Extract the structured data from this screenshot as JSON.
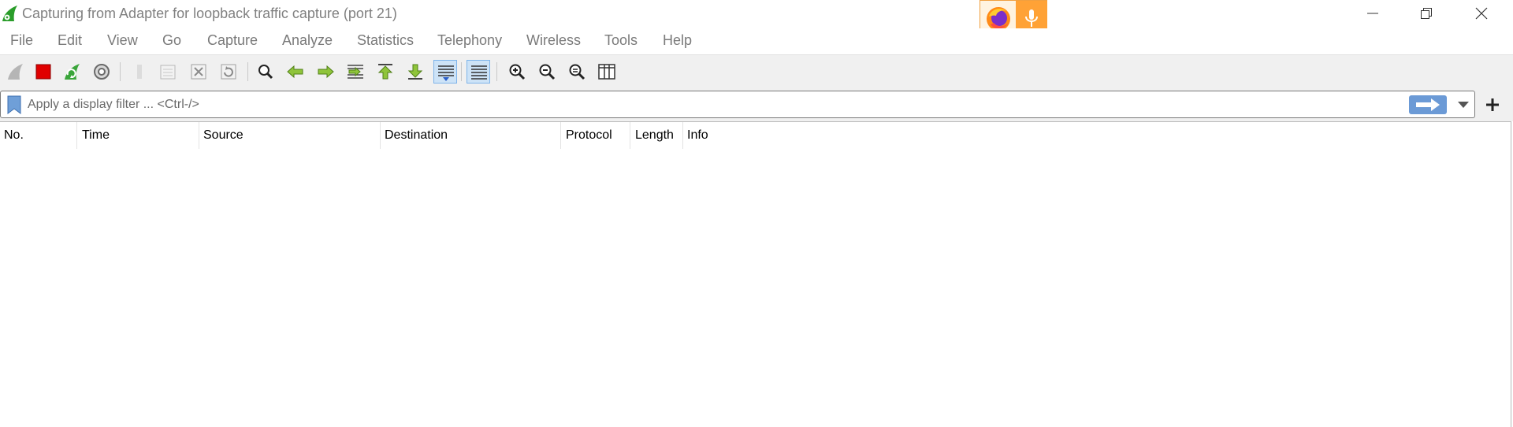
{
  "window": {
    "title": "Capturing from Adapter for loopback traffic capture (port 21)",
    "minimize_icon": "minimize-icon",
    "restore_icon": "restore-icon",
    "close_icon": "close-icon"
  },
  "overlay": {
    "firefox_icon": "firefox-icon",
    "mic_icon": "microphone-icon",
    "accent": "#ffa236"
  },
  "menu": {
    "items": [
      "File",
      "Edit",
      "View",
      "Go",
      "Capture",
      "Analyze",
      "Statistics",
      "Telephony",
      "Wireless",
      "Tools",
      "Help"
    ]
  },
  "toolbar": {
    "buttons": [
      {
        "icon": "start-capture-icon",
        "state": "disabled"
      },
      {
        "icon": "stop-capture-icon",
        "color": "#e00000"
      },
      {
        "icon": "restart-capture-icon"
      },
      {
        "icon": "capture-options-icon"
      },
      {
        "icon": "open-file-icon",
        "state": "disabled"
      },
      {
        "icon": "save-file-icon",
        "state": "disabled"
      },
      {
        "icon": "close-file-icon",
        "state": "disabled"
      },
      {
        "icon": "reload-file-icon",
        "state": "disabled"
      },
      {
        "icon": "find-packet-icon"
      },
      {
        "icon": "go-back-icon"
      },
      {
        "icon": "go-forward-icon"
      },
      {
        "icon": "go-to-packet-icon"
      },
      {
        "icon": "go-to-first-packet-icon"
      },
      {
        "icon": "go-to-last-packet-icon"
      },
      {
        "icon": "auto-scroll-icon",
        "state": "active"
      },
      {
        "icon": "colorize-icon",
        "state": "active"
      },
      {
        "icon": "zoom-in-icon"
      },
      {
        "icon": "zoom-out-icon"
      },
      {
        "icon": "normal-size-icon"
      },
      {
        "icon": "resize-columns-icon"
      }
    ]
  },
  "filter": {
    "placeholder": "Apply a display filter ... <Ctrl-/>",
    "value": "",
    "bookmark_icon": "bookmark-icon",
    "apply_icon": "apply-arrow-icon",
    "dropdown_icon": "chevron-down-icon",
    "add_icon": "plus-icon"
  },
  "packet_list": {
    "columns": [
      "No.",
      "Time",
      "Source",
      "Destination",
      "Protocol",
      "Length",
      "Info"
    ],
    "rows": []
  }
}
